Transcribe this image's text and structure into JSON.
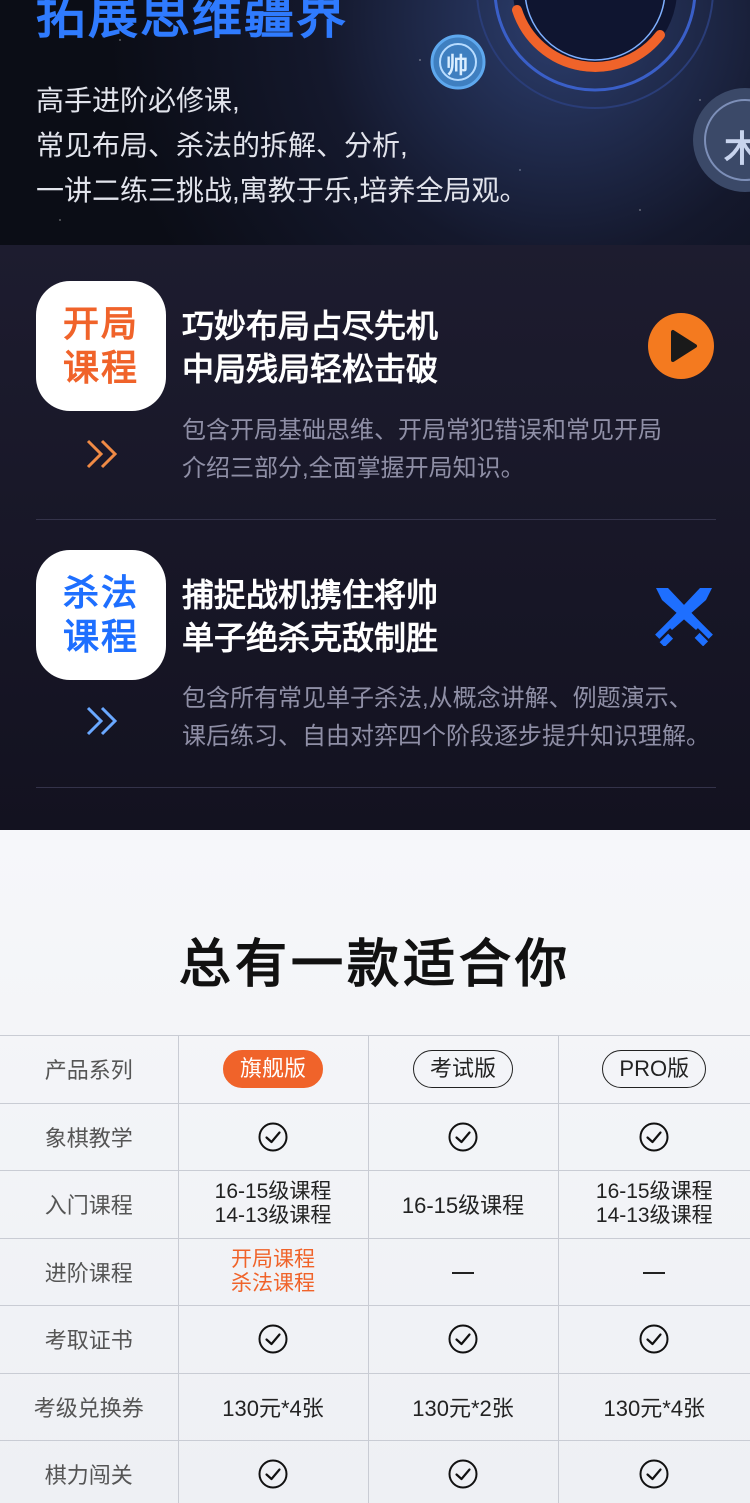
{
  "hero": {
    "title": "拓展思维疆界",
    "lines": [
      "高手进阶必修课,",
      "常见布局、杀法的拆解、分析,",
      "一讲二练三挑战,寓教于乐,培养全局观。"
    ],
    "chess_glyph_1": "帅",
    "chess_glyph_2": "木"
  },
  "courses": [
    {
      "badge": [
        "开局",
        "课程"
      ],
      "badge_color": "#f0632a",
      "arrow_color": "#f08a45",
      "headline": [
        "巧妙布局占尽先机",
        "中局残局轻松击破"
      ],
      "description": [
        "包含开局基础思维、开局常犯错误和常见开局",
        "介绍三部分,全面掌握开局知识。"
      ],
      "icon": "play-icon"
    },
    {
      "badge": [
        "杀法",
        "课程"
      ],
      "badge_color": "#1e6fff",
      "arrow_color": "#5b9bff",
      "headline": [
        "捕捉战机携住将帅",
        "单子绝杀克敌制胜"
      ],
      "description": [
        "包含所有常见单子杀法,从概念讲解、例题演示、",
        "课后练习、自由对弈四个阶段逐步提升知识理解。"
      ],
      "icon": "crossed-swords-icon"
    }
  ],
  "compare": {
    "title": "总有一款适合你",
    "header_label": "产品系列",
    "plans": [
      "旗舰版",
      "考试版",
      "PRO版"
    ],
    "rows": [
      {
        "label": "象棋教学",
        "cells": [
          {
            "type": "check"
          },
          {
            "type": "check"
          },
          {
            "type": "check"
          }
        ]
      },
      {
        "label": "入门课程",
        "cells": [
          {
            "type": "lines",
            "lines": [
              "16-15级课程",
              "14-13级课程"
            ]
          },
          {
            "type": "text",
            "text": "16-15级课程"
          },
          {
            "type": "lines",
            "lines": [
              "16-15级课程",
              "14-13级课程"
            ]
          }
        ]
      },
      {
        "label": "进阶课程",
        "cells": [
          {
            "type": "lines",
            "lines": [
              "开局课程",
              "杀法课程"
            ],
            "highlight": true
          },
          {
            "type": "dash"
          },
          {
            "type": "dash"
          }
        ]
      },
      {
        "label": "考取证书",
        "cells": [
          {
            "type": "check"
          },
          {
            "type": "check"
          },
          {
            "type": "check"
          }
        ]
      },
      {
        "label": "考级兑换券",
        "cells": [
          {
            "type": "text",
            "text": "130元*4张"
          },
          {
            "type": "text",
            "text": "130元*2张"
          },
          {
            "type": "text",
            "text": "130元*4张"
          }
        ]
      },
      {
        "label": "棋力闯关",
        "cells": [
          {
            "type": "check"
          },
          {
            "type": "check"
          },
          {
            "type": "check"
          }
        ]
      }
    ]
  }
}
